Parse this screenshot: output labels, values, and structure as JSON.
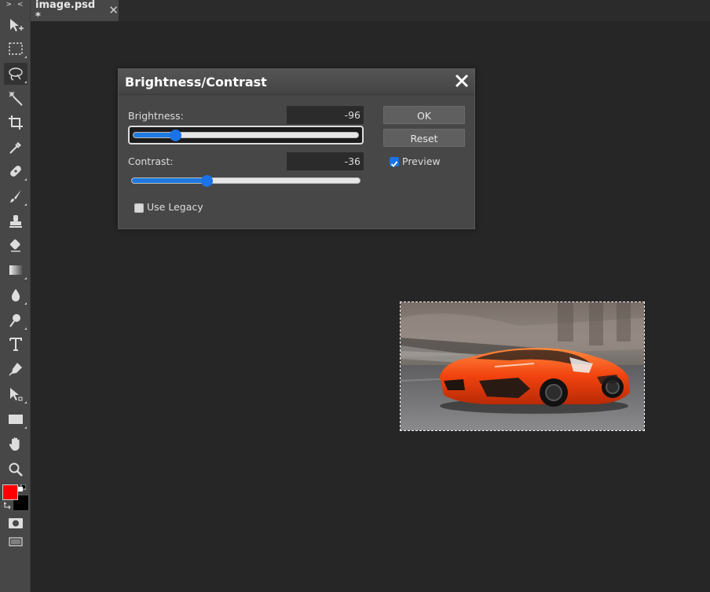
{
  "toolbar": {
    "collapse_label": "> <",
    "tools": [
      "move-tool-icon",
      "marquee-select-icon",
      "lasso-icon",
      "magic-wand-icon",
      "crop-icon",
      "eyedropper-icon",
      "healing-brush-icon",
      "brush-icon",
      "clone-stamp-icon",
      "eraser-icon",
      "gradient-icon",
      "blur-icon",
      "dodge-icon",
      "type-tool-icon",
      "pen-icon",
      "path-select-icon",
      "rectangle-tool-icon",
      "hand-icon",
      "zoom-icon"
    ],
    "active_tool": "lasso-icon",
    "foreground_color": "#ff0000",
    "background_color": "#000000"
  },
  "tabs": [
    {
      "label": "image.psd *"
    }
  ],
  "dialog": {
    "title": "Brightness/Contrast",
    "brightness": {
      "label": "Brightness:",
      "value": "-96",
      "fraction": 0.19
    },
    "contrast": {
      "label": "Contrast:",
      "value": "-36",
      "fraction": 0.33
    },
    "ok_label": "OK",
    "reset_label": "Reset",
    "preview_label": "Preview",
    "preview_checked": true,
    "legacy_label": "Use Legacy",
    "legacy_checked": false
  },
  "colors": {
    "accent": "#1a73e8",
    "panel": "#474747",
    "workspace": "#262626"
  }
}
